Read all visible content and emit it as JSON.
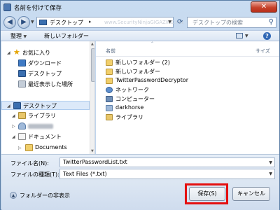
{
  "window": {
    "title": "名前を付けて保存",
    "close_glyph": "✕"
  },
  "address": {
    "location": "デスクトップ",
    "separator": "▸",
    "watermark": "www.SecurityNinjaGIGAZINE.net",
    "search_placeholder": "デスクトップの検索"
  },
  "toolbar": {
    "organize": "整理",
    "new_folder": "新しいフォルダー",
    "help": "?"
  },
  "nav": {
    "favorites": "お気に入り",
    "downloads": "ダウンロード",
    "desktop": "デスクトップ",
    "recent": "最近表示した場所",
    "desktop_root": "デスクトップ",
    "libraries": "ライブラリ",
    "documents": "ドキュメント",
    "documents_sub": "Documents"
  },
  "filelist": {
    "col_name": "名前",
    "col_size": "サイズ",
    "items": [
      {
        "label": "新しいフォルダー (2)",
        "icon": "folder-icon"
      },
      {
        "label": "新しいフォルダー",
        "icon": "folder-icon"
      },
      {
        "label": "TwitterPasswordDecryptor",
        "icon": "folder-icon"
      },
      {
        "label": "ネットワーク",
        "icon": "network-icon"
      },
      {
        "label": "コンピューター",
        "icon": "computer-icon"
      },
      {
        "label": "darkhorse",
        "icon": "user-icon"
      },
      {
        "label": "ライブラリ",
        "icon": "library-icon"
      }
    ]
  },
  "form": {
    "filename_label": "ファイル名(N):",
    "filename_value": "TwitterPasswordList.txt",
    "filetype_label": "ファイルの種類(T):",
    "filetype_value": "Text Files (*.txt)"
  },
  "footer": {
    "hide_folders": "フォルダーの非表示",
    "save": "保存(S)",
    "cancel": "キャンセル"
  },
  "colors": {
    "highlight": "#e51010",
    "selection": "#dce9f9"
  }
}
